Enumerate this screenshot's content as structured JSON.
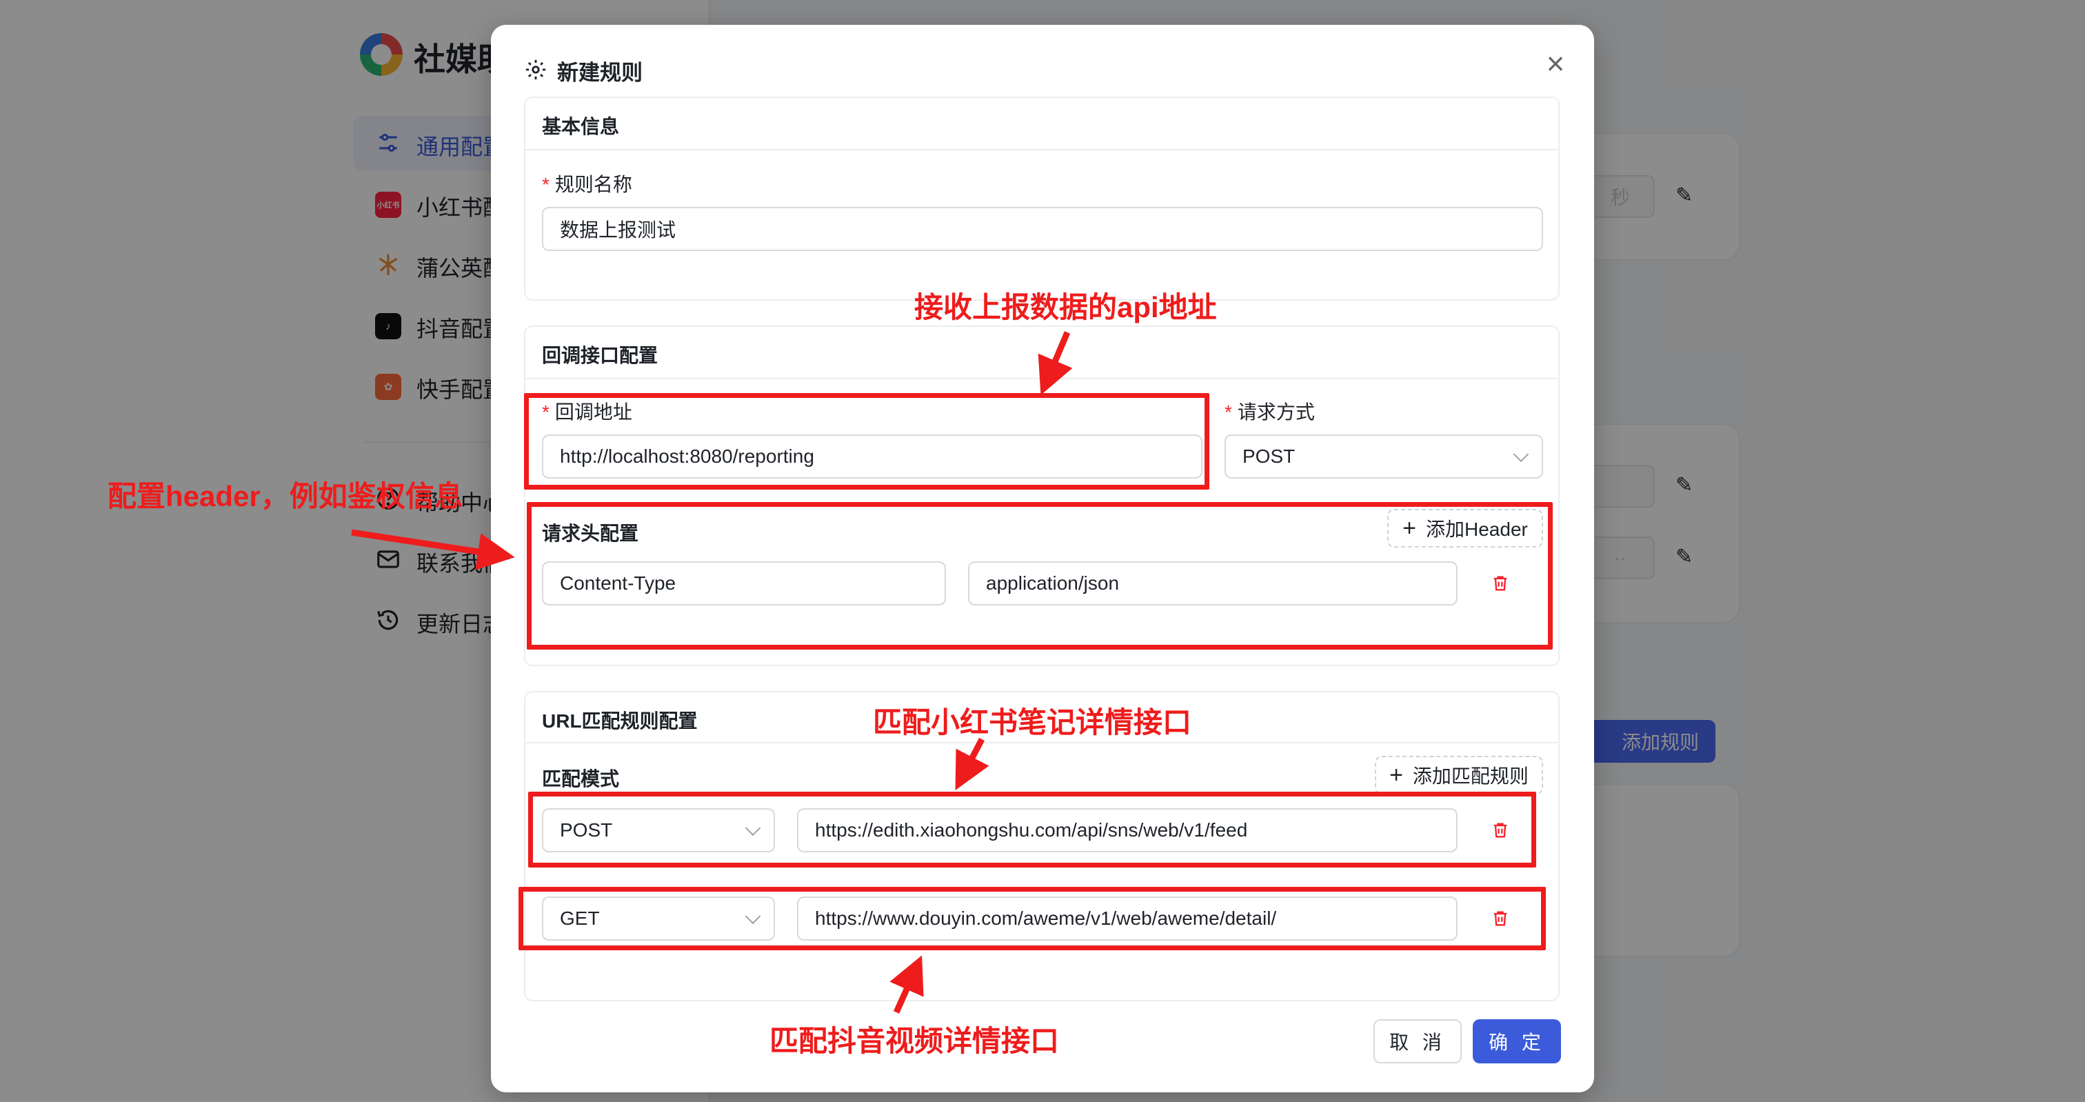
{
  "app": {
    "brand": "社媒助",
    "nav": [
      {
        "label": "通用配置",
        "icon": "sliders-icon"
      },
      {
        "label": "小红书配置",
        "icon": "xiaohongshu-icon",
        "badge": "小红书"
      },
      {
        "label": "蒲公英配置",
        "icon": "dandelion-icon"
      },
      {
        "label": "抖音配置",
        "icon": "douyin-icon"
      },
      {
        "label": "快手配置",
        "icon": "kuaishou-icon"
      },
      {
        "label": "帮助中心",
        "icon": "help-circle-icon"
      },
      {
        "label": "联系我们",
        "icon": "mail-icon"
      },
      {
        "label": "更新日志",
        "icon": "history-icon"
      }
    ],
    "bg_unit": "秒",
    "bg_add_rule": "添加规则"
  },
  "modal": {
    "title": "新建规则",
    "basic": {
      "heading": "基本信息",
      "name_label": "规则名称",
      "name_value": "数据上报测试"
    },
    "callback": {
      "heading": "回调接口配置",
      "url_label": "回调地址",
      "url_value": "http://localhost:8080/reporting",
      "method_label": "请求方式",
      "method_value": "POST"
    },
    "headers": {
      "heading": "请求头配置",
      "add_label": "添加Header",
      "rows": [
        {
          "key": "Content-Type",
          "value": "application/json"
        }
      ]
    },
    "url_match": {
      "heading": "URL匹配规则配置",
      "mode_label": "匹配模式",
      "add_label": "添加匹配规则",
      "rules": [
        {
          "method": "POST",
          "url": "https://edith.xiaohongshu.com/api/sns/web/v1/feed"
        },
        {
          "method": "GET",
          "url": "https://www.douyin.com/aweme/v1/web/aweme/detail/"
        }
      ]
    },
    "cancel_label": "取 消",
    "ok_label": "确 定"
  },
  "annotations": {
    "api": "接收上报数据的api地址",
    "header": "配置header，例如鉴权信息",
    "xhs": "匹配小红书笔记详情接口",
    "douyin": "匹配抖音视频详情接口",
    "color": "#ee1c1c"
  },
  "colors": {
    "primary": "#3b5bdb",
    "danger": "#f5222d"
  }
}
